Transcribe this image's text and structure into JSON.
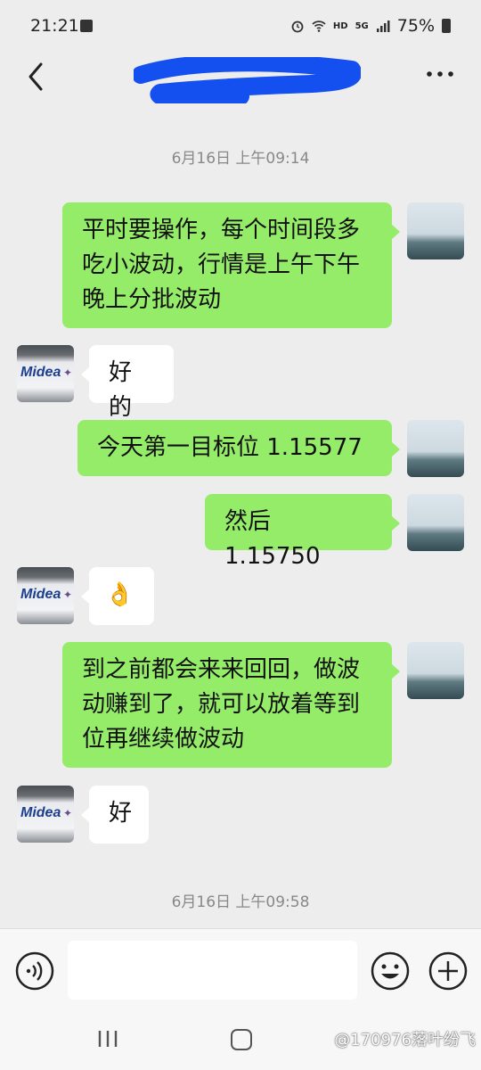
{
  "status_bar": {
    "time": "21:21",
    "network": "5G",
    "hd": "HD",
    "battery": "75%"
  },
  "header": {
    "back_icon": "chevron-left-icon",
    "more_icon": "more-dots-icon"
  },
  "timestamps": [
    "6月16日 上午09:14",
    "6月16日 上午09:58"
  ],
  "messages": [
    {
      "side": "out",
      "text": "平时要操作，每个时间段多\n吃小波动，行情是上午下午\n晚上分批波动"
    },
    {
      "side": "in",
      "text": "好的"
    },
    {
      "side": "out",
      "text": "今天第一目标位 1.15577"
    },
    {
      "side": "out",
      "text": "然后 1.15750"
    },
    {
      "side": "in",
      "text": "👌"
    },
    {
      "side": "out",
      "text": "到之前都会来来回回，做波\n动赚到了，就可以放着等到\n位再继续做波动"
    },
    {
      "side": "in",
      "text": "好"
    }
  ],
  "avatars": {
    "contact_logo": "Midea"
  },
  "input_bar": {
    "value": "",
    "voice_icon": "voice-icon",
    "emoji_icon": "emoji-icon",
    "plus_icon": "plus-icon"
  },
  "nav": {
    "watermark": "@170976落叶纷飞"
  },
  "colors": {
    "outgoing_bubble": "#95ec69",
    "incoming_bubble": "#ffffff",
    "background": "#ededed",
    "redaction": "#1450f0"
  }
}
